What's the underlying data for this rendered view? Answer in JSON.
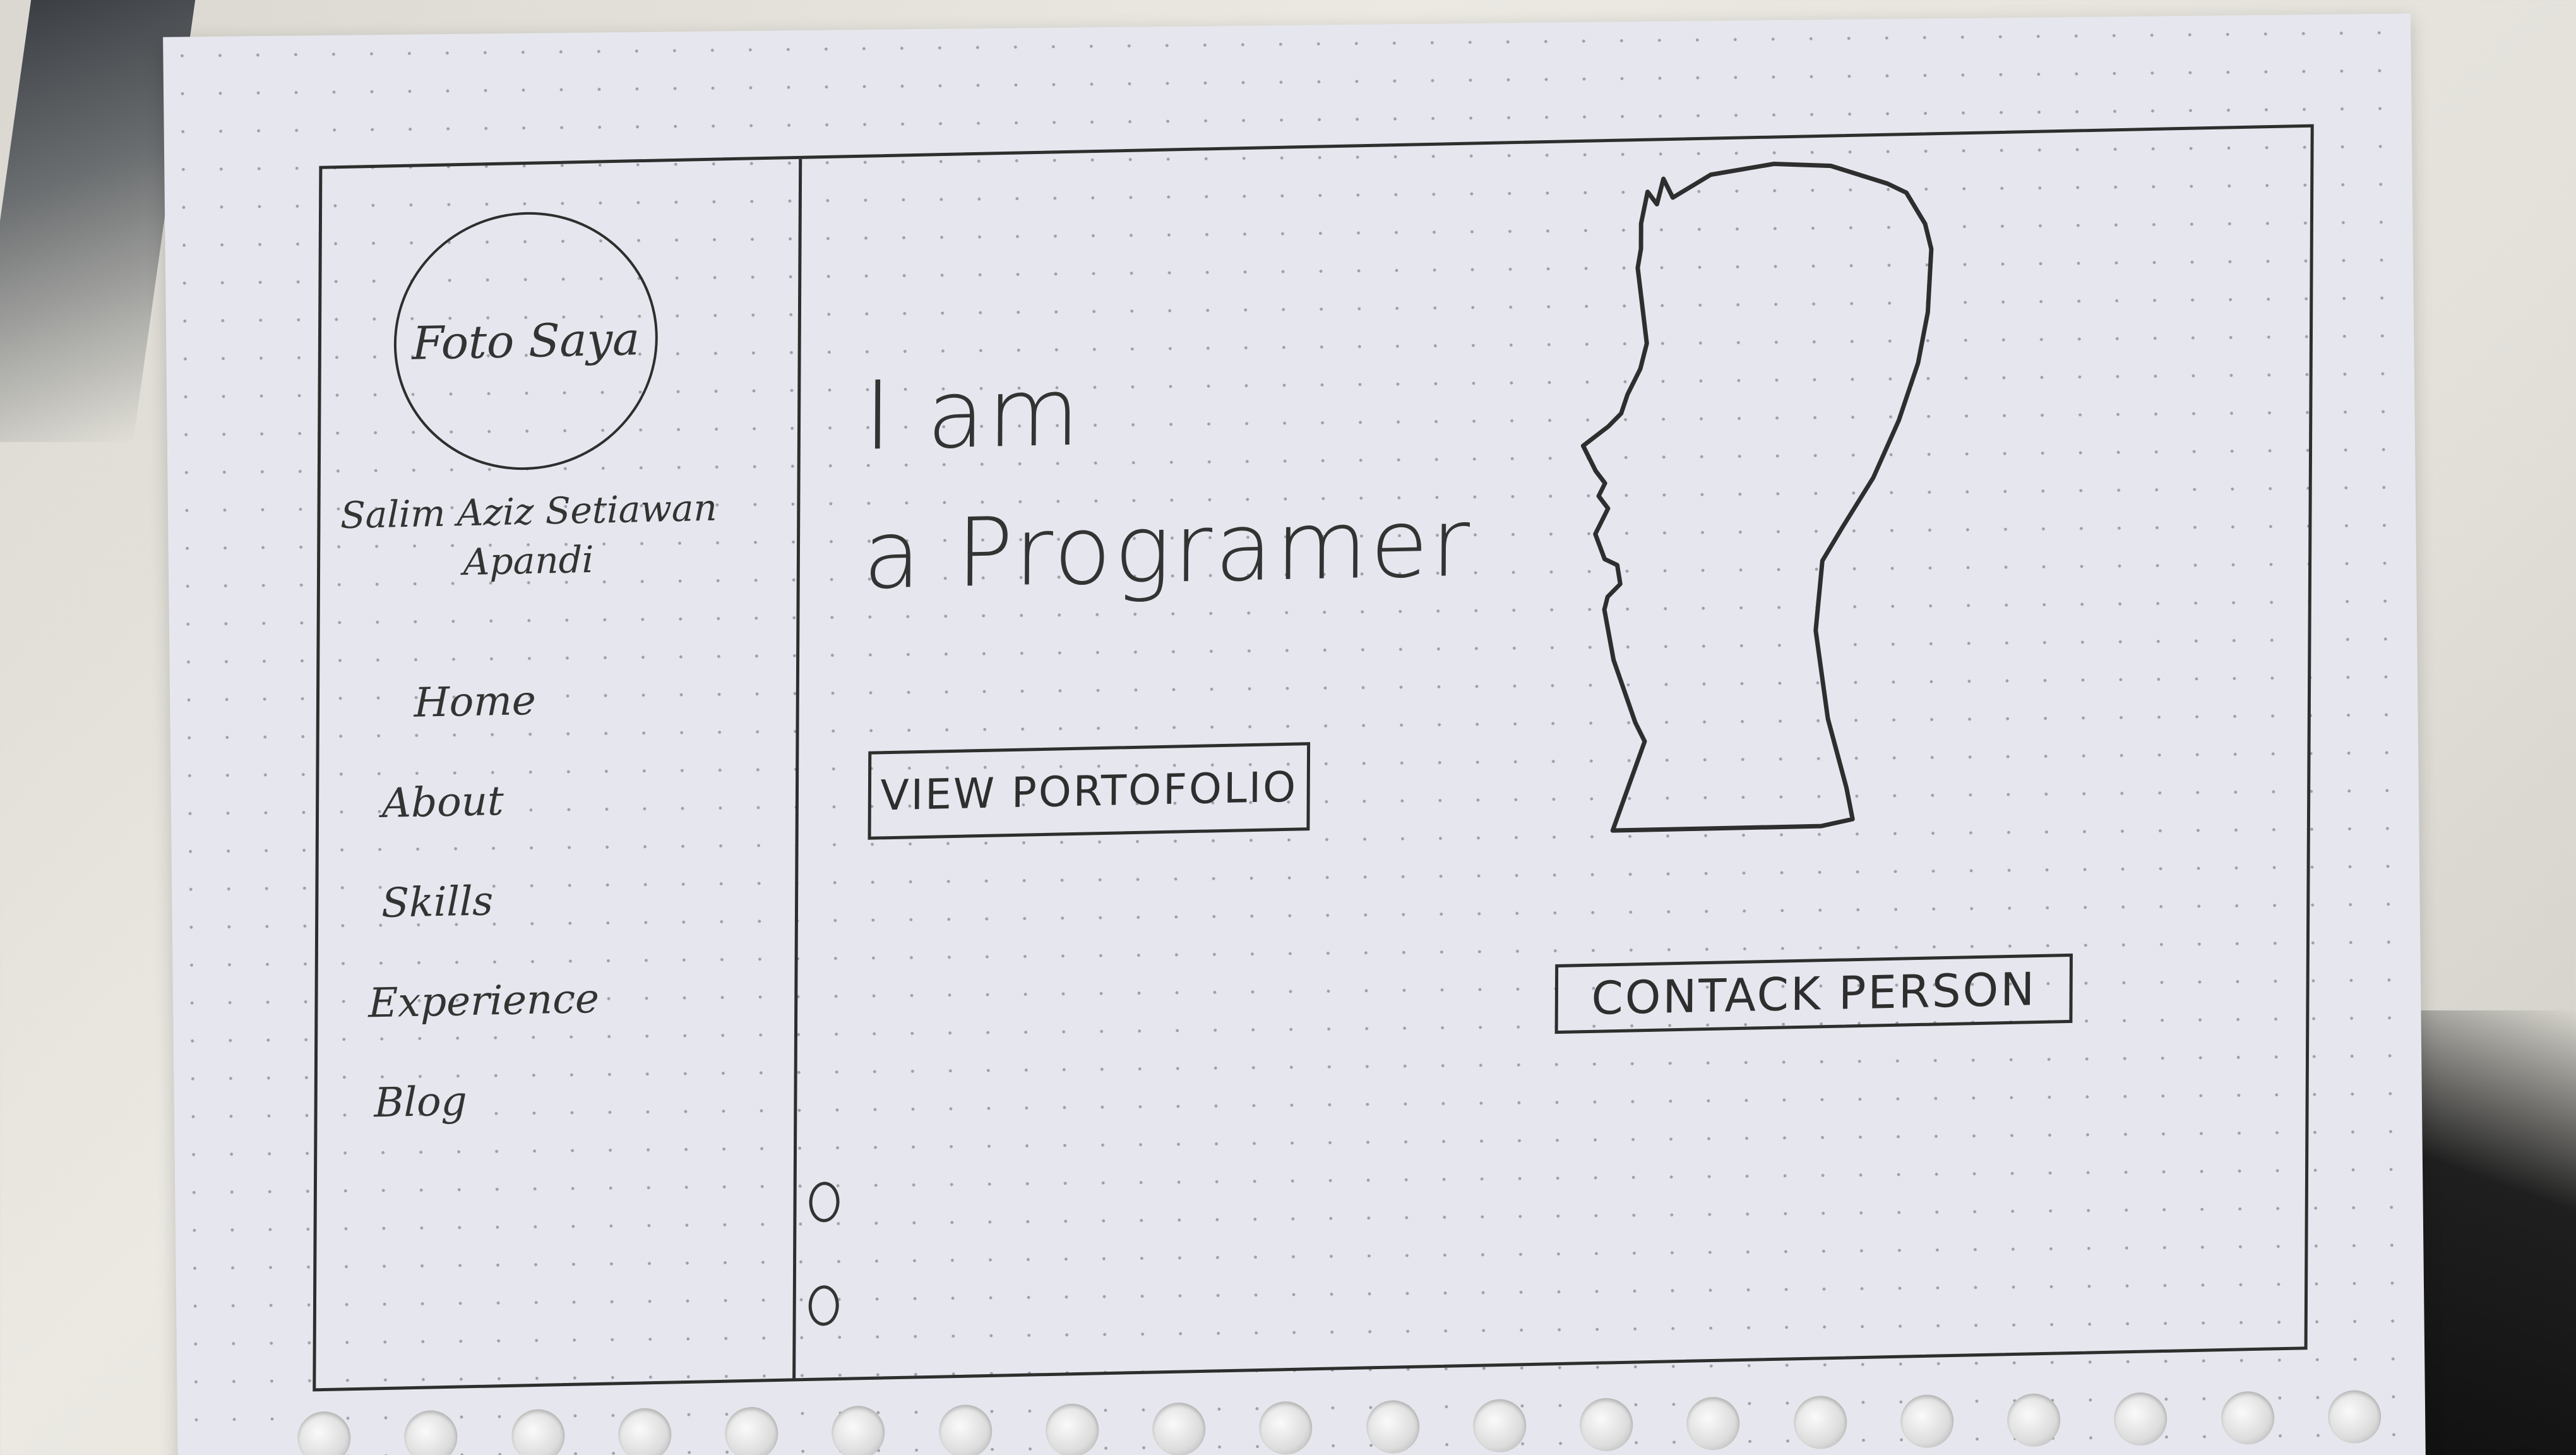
{
  "profile": {
    "photo_placeholder": "Foto Saya",
    "name": "Salim Aziz Setiawan Apandi"
  },
  "nav": {
    "items": [
      {
        "label": "Home"
      },
      {
        "label": "About"
      },
      {
        "label": "Skills"
      },
      {
        "label": "Experience"
      },
      {
        "label": "Blog"
      }
    ]
  },
  "hero": {
    "line1": "I am",
    "line2": "a Programer",
    "portfolio_button": "VIEW PORTOFOLIO",
    "contact_button": "CONTACK PERSON"
  },
  "slider": {
    "dot_count": 2
  }
}
